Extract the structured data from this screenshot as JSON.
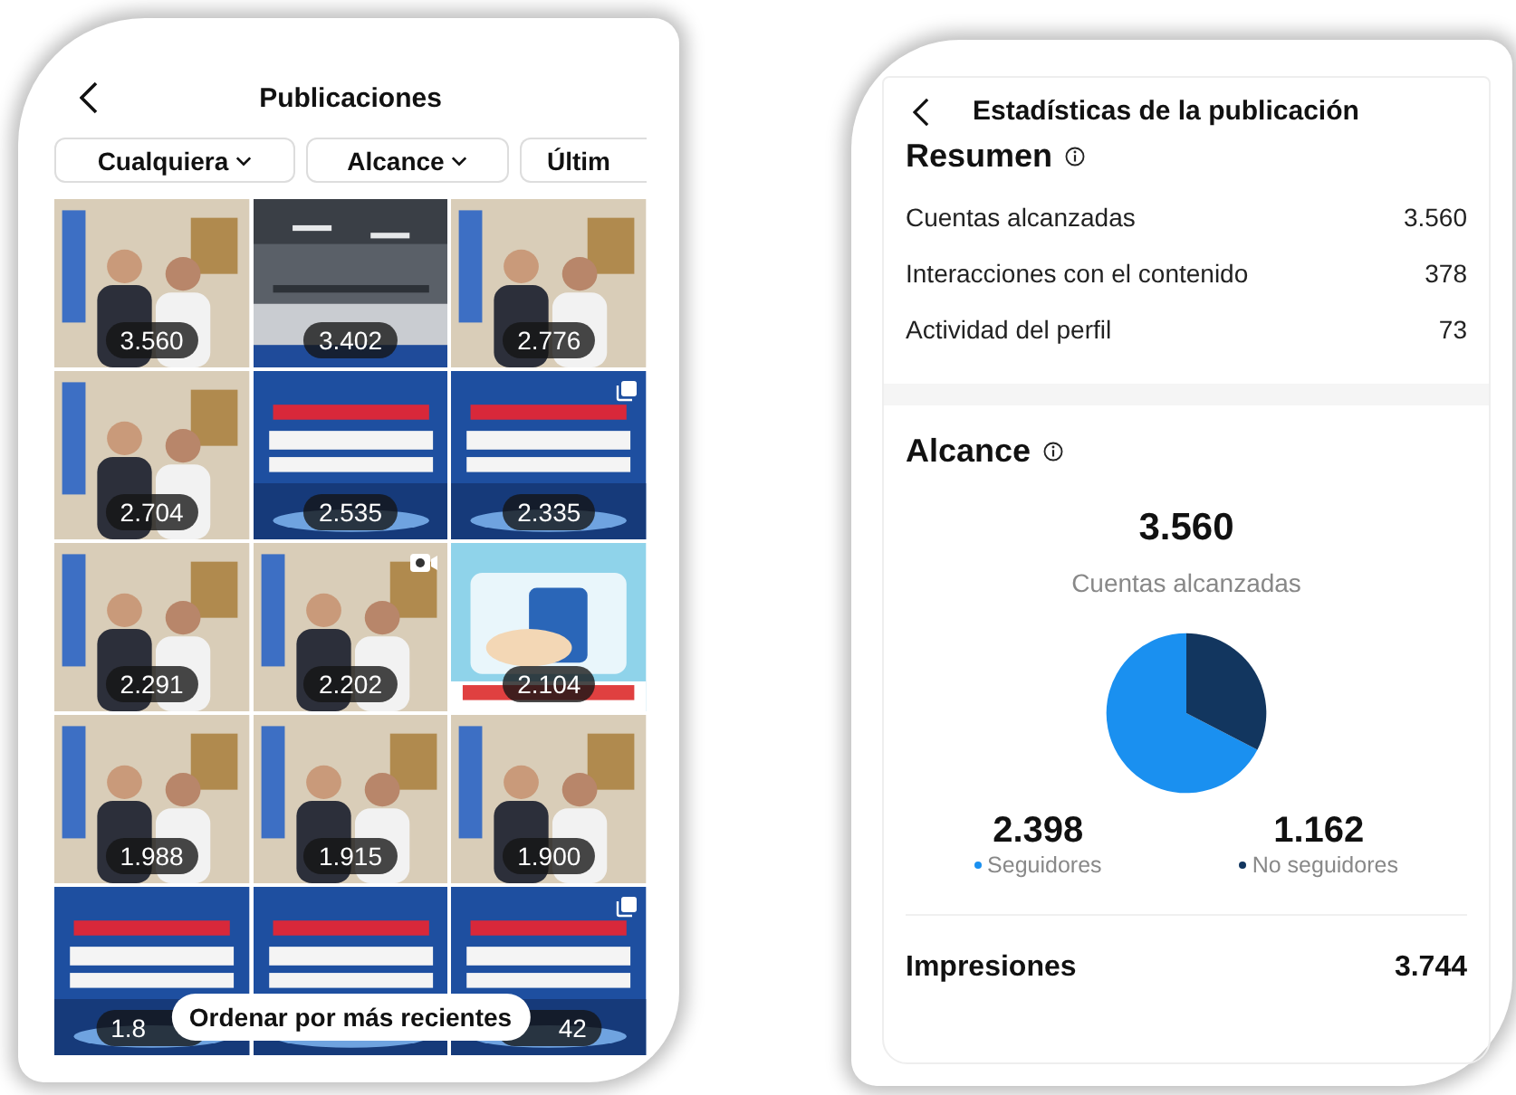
{
  "posts_screen": {
    "title": "Publicaciones",
    "filters": [
      {
        "label": "Cualquiera",
        "dropdown": true
      },
      {
        "label": "Alcance",
        "dropdown": true
      },
      {
        "label": "Últim",
        "dropdown": false
      }
    ],
    "posts": [
      {
        "count": "3.560",
        "carousel": false,
        "video": false
      },
      {
        "count": "3.402",
        "carousel": false,
        "video": false
      },
      {
        "count": "2.776",
        "carousel": false,
        "video": false
      },
      {
        "count": "2.704",
        "carousel": false,
        "video": false
      },
      {
        "count": "2.535",
        "carousel": false,
        "video": false
      },
      {
        "count": "2.335",
        "carousel": true,
        "video": false
      },
      {
        "count": "2.291",
        "carousel": false,
        "video": false
      },
      {
        "count": "2.202",
        "carousel": false,
        "video": true
      },
      {
        "count": "2.104",
        "carousel": false,
        "video": false
      },
      {
        "count": "1.988",
        "carousel": false,
        "video": false
      },
      {
        "count": "1.915",
        "carousel": false,
        "video": false
      },
      {
        "count": "1.900",
        "carousel": false,
        "video": false
      },
      {
        "count": "1.8",
        "carousel": false,
        "video": false
      },
      {
        "carousel": false,
        "video": false
      },
      {
        "count": "42",
        "carousel": true,
        "video": false
      }
    ],
    "sort_button": "Ordenar por más recientes"
  },
  "stats_screen": {
    "title": "Estadísticas de la publicación",
    "summary": {
      "heading": "Resumen",
      "rows": [
        {
          "label": "Cuentas alcanzadas",
          "value": "3.560"
        },
        {
          "label": "Interacciones con el contenido",
          "value": "378"
        },
        {
          "label": "Actividad del perfil",
          "value": "73"
        }
      ]
    },
    "reach": {
      "heading": "Alcance",
      "total": "3.560",
      "total_label": "Cuentas alcanzadas",
      "chart_data": {
        "type": "pie",
        "categories": [
          "Seguidores",
          "No seguidores"
        ],
        "values": [
          67.4,
          32.6
        ]
      },
      "legend": [
        {
          "value": "2.398",
          "color": "#1a90f0"
        },
        {
          "value": "1.162",
          "color": "#12365f"
        }
      ]
    },
    "impressions": {
      "label": "Impresiones",
      "value": "3.744"
    }
  }
}
